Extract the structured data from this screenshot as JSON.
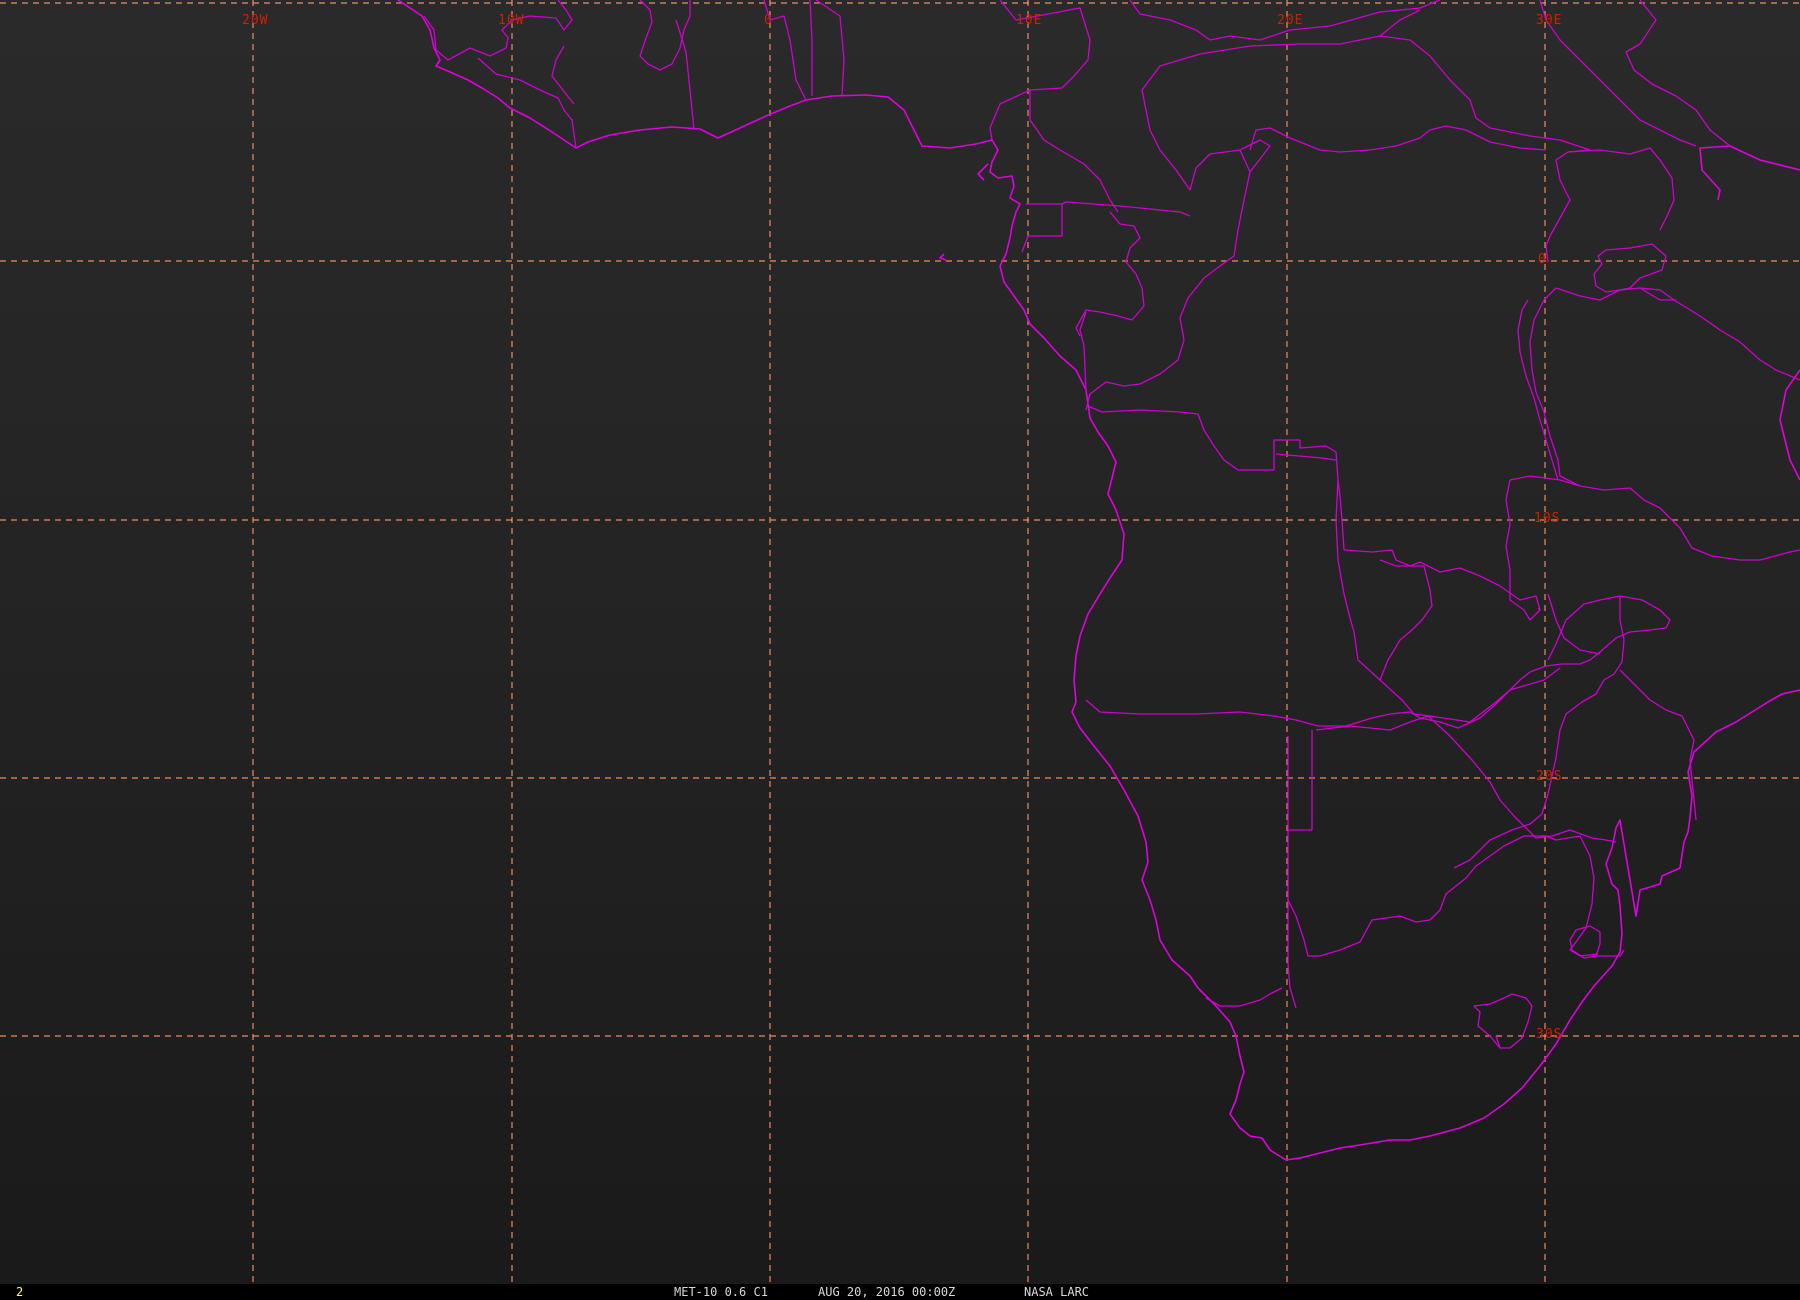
{
  "map": {
    "longitude_labels": [
      "20W",
      "10W",
      "0",
      "10E",
      "20E",
      "30E"
    ],
    "latitude_labels": [
      "0",
      "10S",
      "20S",
      "30S"
    ],
    "colors": {
      "background": "#1e1e1e",
      "boundaries": "#e000e0",
      "graticule": "#ff9966",
      "graticule_labels": "#cc2200"
    },
    "features": [
      "african-coastline",
      "country-borders",
      "lat-lon-graticule"
    ]
  },
  "status": {
    "frame": "2",
    "product": "MET-10 0.6 C1",
    "datetime": "AUG 20, 2016 00:00Z",
    "source": "NASA LARC"
  }
}
